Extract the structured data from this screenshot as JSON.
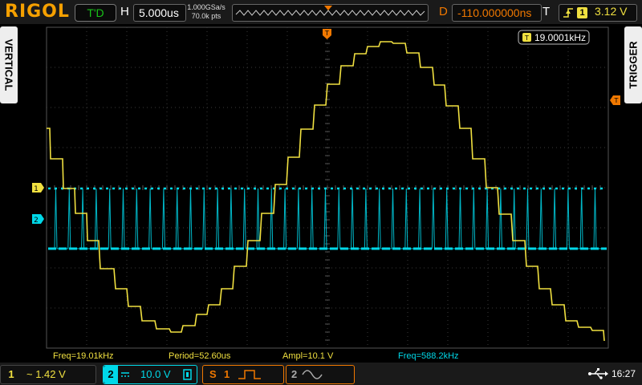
{
  "header": {
    "brand": "RIGOL",
    "run_state": "T'D",
    "timebase_label": "H",
    "timebase_value": "5.000us",
    "sample_rate": "1.000GSa/s",
    "memory_depth": "70.0k pts",
    "delay_label": "D",
    "delay_value": "-110.000000ns",
    "trigger_label": "T",
    "trigger_source": "1",
    "trigger_level": "3.12 V"
  },
  "side_tabs": {
    "left": "VERTICAL",
    "right": "TRIGGER"
  },
  "frequency_counter": "19.0001kHz",
  "channel_markers": {
    "ch1": "1",
    "ch2": "2",
    "trigger_marker": "T"
  },
  "measurements": {
    "freq": "Freq=19.01kHz",
    "period": "Period=52.60us",
    "ampl": "Ampl=10.1 V",
    "freq2": "Freq=588.2kHz"
  },
  "footer": {
    "ch1_num": "1",
    "ch1_value": "~ 1.42 V",
    "ch2_num": "2",
    "ch2_value": "10.0 V",
    "math_label": "S",
    "math_num": "1",
    "ref_num": "2",
    "time": "16:27"
  },
  "colors": {
    "ch1": "#f0e040",
    "ch2": "#00d8e8",
    "trigger": "#f07800",
    "brand": "#f5a000"
  }
}
